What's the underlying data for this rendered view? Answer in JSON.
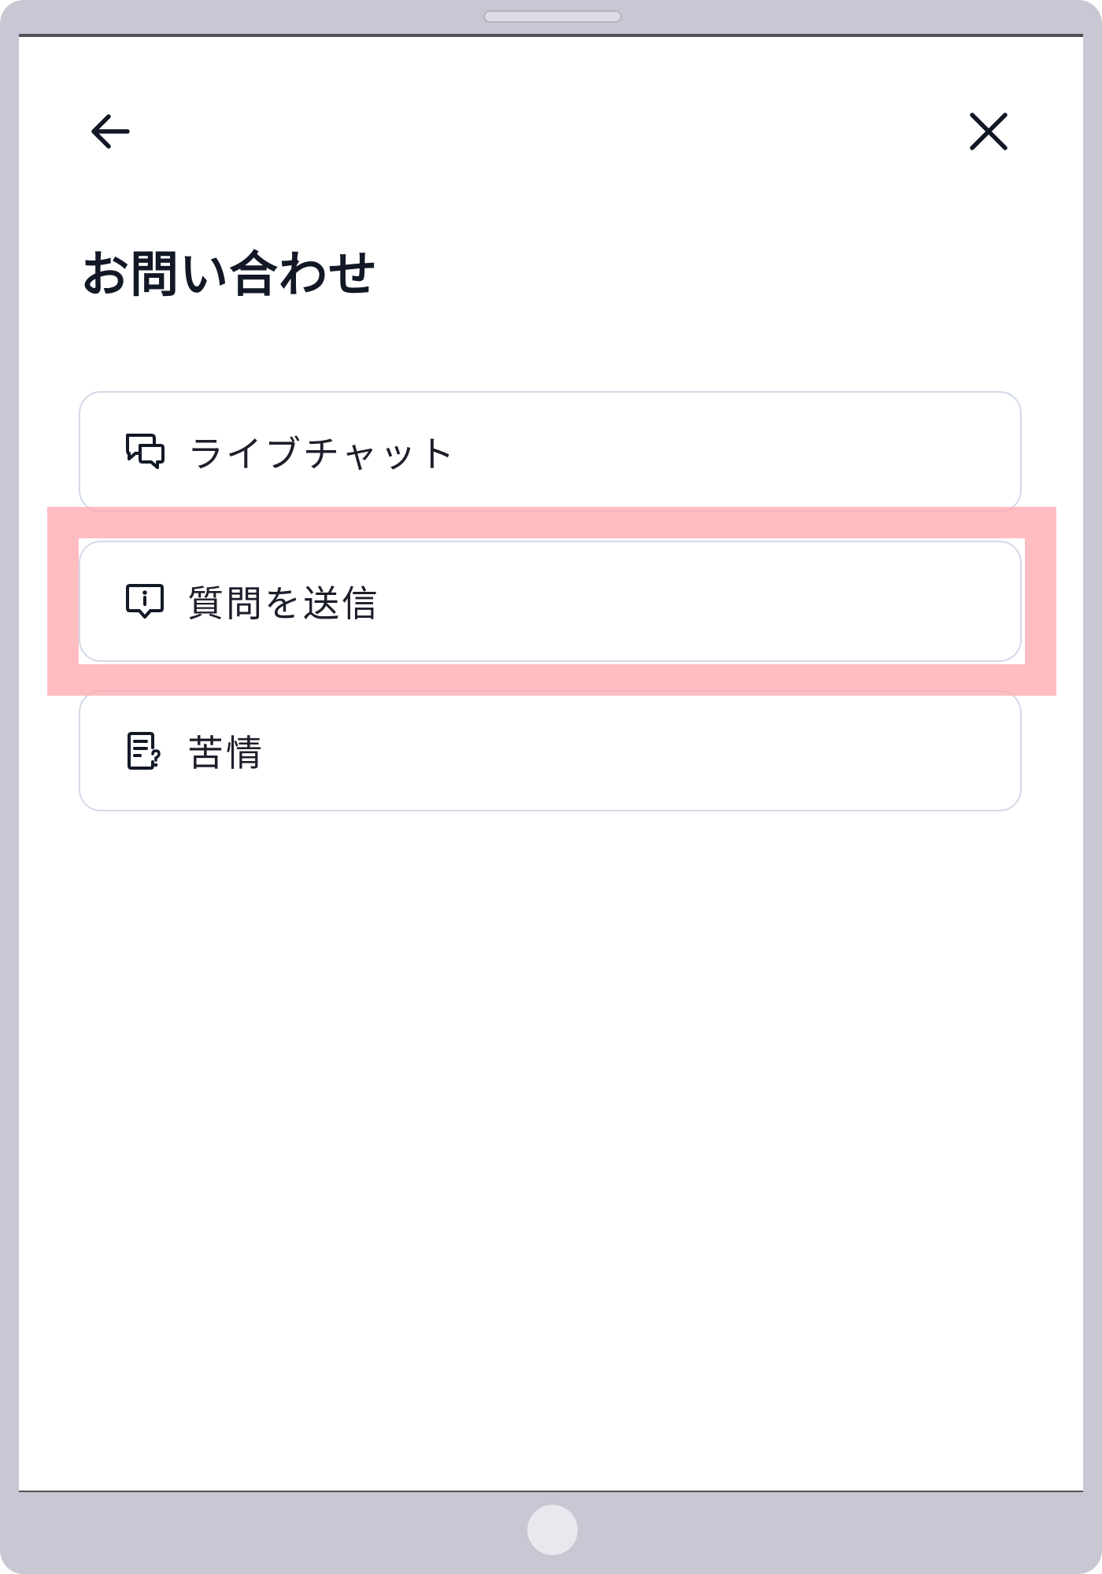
{
  "header": {
    "back_icon": "arrow-left-icon",
    "close_icon": "close-icon",
    "title": "お問い合わせ"
  },
  "options": [
    {
      "label": "ライブチャット",
      "icon": "chat-bubbles-icon"
    },
    {
      "label": "質問を送信",
      "icon": "message-info-icon"
    },
    {
      "label": "苦情",
      "icon": "document-question-icon"
    }
  ],
  "highlight": {
    "target": "質問を送信",
    "color": "#ffaaaf"
  },
  "colors": {
    "text": "#121826",
    "border": "#d2dae8",
    "device_frame": "#c8c8d4"
  }
}
